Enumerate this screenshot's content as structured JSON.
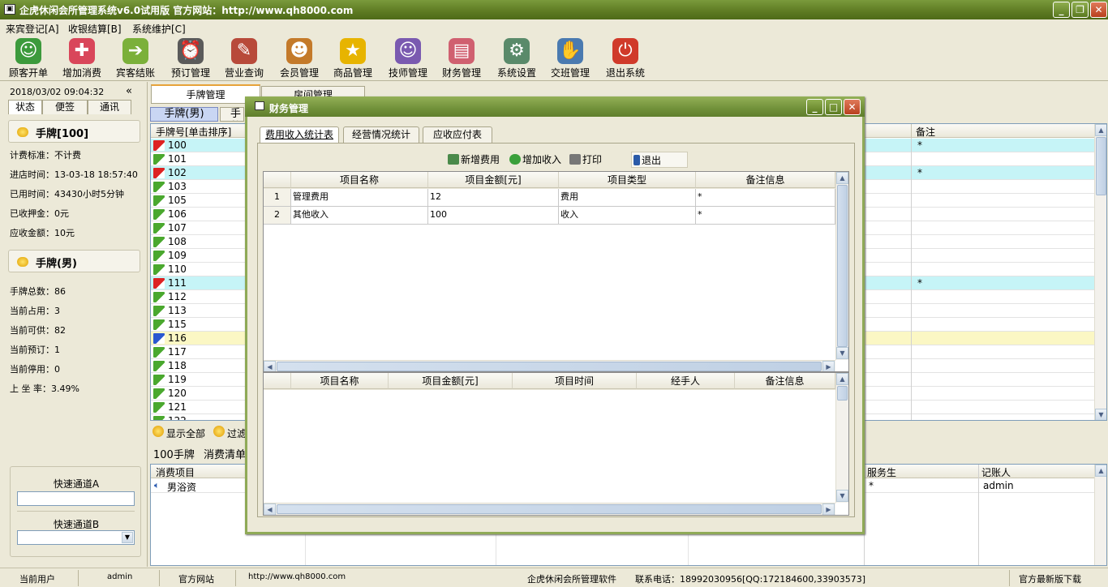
{
  "window": {
    "title": "企虎休闲会所管理系统v6.0试用版    官方网站：http://www.qh8000.com"
  },
  "menu": [
    "来宾登记[A]",
    "收银结算[B]",
    "系统维护[C]"
  ],
  "toolbar": [
    {
      "label": "顾客开单",
      "icon": "customer-icon",
      "color": "#3c9a3c",
      "glyph": "☺"
    },
    {
      "label": "增加消费",
      "icon": "add-consumption-icon",
      "color": "#d9465a",
      "glyph": "✚"
    },
    {
      "label": "宾客结账",
      "icon": "checkout-icon",
      "color": "#7bb03a",
      "glyph": "➔"
    },
    {
      "label": "预订管理",
      "icon": "alarm-clock-icon",
      "color": "#5a5a5a",
      "glyph": "⏰"
    },
    {
      "label": "营业查询",
      "icon": "query-icon",
      "color": "#b84a3a",
      "glyph": "✎"
    },
    {
      "label": "会员管理",
      "icon": "members-icon",
      "color": "#c47a2a",
      "glyph": "☻"
    },
    {
      "label": "商品管理",
      "icon": "star-icon",
      "color": "#e7b400",
      "glyph": "★"
    },
    {
      "label": "技师管理",
      "icon": "technician-icon",
      "color": "#7a5ab0",
      "glyph": "☺"
    },
    {
      "label": "财务管理",
      "icon": "finance-icon",
      "color": "#d06070",
      "glyph": "▤"
    },
    {
      "label": "系统设置",
      "icon": "settings-icon",
      "color": "#5a8a6a",
      "glyph": "⚙"
    },
    {
      "label": "交班管理",
      "icon": "handshake-icon",
      "color": "#4a7ab0",
      "glyph": "✋"
    },
    {
      "label": "退出系统",
      "icon": "exit-icon",
      "color": "#d03a2a",
      "glyph": "⏻"
    }
  ],
  "left": {
    "datetime": "2018/03/02  09:04:32",
    "tabs": [
      "状态",
      "便签",
      "通讯"
    ],
    "card1_title": "手牌[100]",
    "card1_rows": [
      "计费标准：不计费",
      "进店时间：13-03-18 18:57:40",
      "已用时间：43430小时5分钟",
      "已收押金：0元",
      "应收金额：10元"
    ],
    "card2_title": "手牌(男)",
    "card2_rows": [
      "手牌总数：86",
      "当前占用：3",
      "当前可供：82",
      "当前预订：1",
      "当前停用：0",
      "上 坐 率：3.49%"
    ],
    "quickA": "快速通道A",
    "quickB": "快速通道B"
  },
  "main": {
    "tabs": [
      "手牌管理",
      "房间管理"
    ],
    "subtab": "手牌(男)",
    "subtab2": "手牌",
    "col_header": "手牌号[单击排序]",
    "col_remark": "备注",
    "rows": [
      {
        "no": "100",
        "status": "red",
        "remark": "*"
      },
      {
        "no": "101",
        "status": "green",
        "remark": ""
      },
      {
        "no": "102",
        "status": "red",
        "remark": "*"
      },
      {
        "no": "103",
        "status": "green",
        "remark": ""
      },
      {
        "no": "105",
        "status": "green",
        "remark": ""
      },
      {
        "no": "106",
        "status": "green",
        "remark": ""
      },
      {
        "no": "107",
        "status": "green",
        "remark": ""
      },
      {
        "no": "108",
        "status": "green",
        "remark": ""
      },
      {
        "no": "109",
        "status": "green",
        "remark": ""
      },
      {
        "no": "110",
        "status": "green",
        "remark": ""
      },
      {
        "no": "111",
        "status": "red",
        "remark": "*"
      },
      {
        "no": "112",
        "status": "green",
        "remark": ""
      },
      {
        "no": "113",
        "status": "green",
        "remark": ""
      },
      {
        "no": "115",
        "status": "green",
        "remark": ""
      },
      {
        "no": "116",
        "status": "blue",
        "remark": ""
      },
      {
        "no": "117",
        "status": "green",
        "remark": ""
      },
      {
        "no": "118",
        "status": "green",
        "remark": ""
      },
      {
        "no": "119",
        "status": "green",
        "remark": ""
      },
      {
        "no": "120",
        "status": "green",
        "remark": ""
      },
      {
        "no": "121",
        "status": "green",
        "remark": ""
      },
      {
        "no": "122",
        "status": "green",
        "remark": ""
      }
    ],
    "show_all": "显示全部",
    "filter": "过滤",
    "detail_title": "100手牌",
    "detail_sub": "消费清单",
    "bottom_headers": {
      "item": "消费项目",
      "waiter": "服务生",
      "recorder": "记账人"
    },
    "bottom_row": {
      "item": "男浴资",
      "waiter": "*",
      "recorder": "admin"
    }
  },
  "dialog": {
    "title": "财务管理",
    "tabs": [
      "费用收入统计表",
      "经营情况统计",
      "应收应付表"
    ],
    "buttons": [
      "新增费用",
      "增加收入",
      "打印",
      "退出"
    ],
    "top_headers": [
      "项目名称",
      "项目金额[元]",
      "项目类型",
      "备注信息"
    ],
    "top_rows": [
      {
        "idx": "1",
        "name": "管理费用",
        "amount": "12",
        "type": "费用",
        "note": "*"
      },
      {
        "idx": "2",
        "name": "其他收入",
        "amount": "100",
        "type": "收入",
        "note": "*"
      }
    ],
    "bottom_headers": [
      "项目名称",
      "项目金额[元]",
      "项目时间",
      "经手人",
      "备注信息"
    ]
  },
  "status": {
    "user_label": "当前用户",
    "user": "admin",
    "site_label": "官方网站",
    "site": "http://www.qh8000.com",
    "software": "企虎休闲会所管理软件",
    "phone": "联系电话：18992030956[QQ:172184600,33903573]",
    "download": "官方最新版下载"
  }
}
